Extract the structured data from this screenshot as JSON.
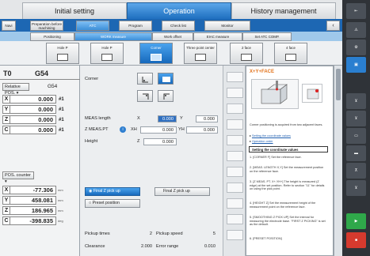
{
  "top_tabs": [
    "Initial setting",
    "Operation",
    "History management"
  ],
  "nav_tabs": [
    "Navi",
    "Preparation before machining",
    "ATC",
    "Program",
    "Check list",
    "Monitor"
  ],
  "measure_tabs": [
    "Positioning",
    "WORK measure",
    "Work offset",
    "EIAC measure",
    "Set ATC COMP."
  ],
  "sub_tabs": [
    "Hole P",
    "Hole P",
    "Corner",
    "Three point center",
    "2 face",
    "4 face"
  ],
  "status": {
    "tool": "T0",
    "gcode": "G54",
    "pos_mode": "Relative POS.",
    "pos_g": "G54"
  },
  "relative_pos": [
    {
      "axis": "X",
      "value": "0.000",
      "suffix": "#1"
    },
    {
      "axis": "Y",
      "value": "0.000",
      "suffix": "#1"
    },
    {
      "axis": "Z",
      "value": "0.000",
      "suffix": "#1"
    },
    {
      "axis": "C",
      "value": "0.000",
      "suffix": "#1"
    }
  ],
  "pos_counter_label": "POS. counter",
  "pos_counter": [
    {
      "axis": "X",
      "value": "-77.306",
      "unit": "mm"
    },
    {
      "axis": "Y",
      "value": "458.081",
      "unit": "mm"
    },
    {
      "axis": "Z",
      "value": "186.965",
      "unit": "mm"
    },
    {
      "axis": "C",
      "value": "-398.835",
      "unit": "deg"
    }
  ],
  "form": {
    "corner_label": "Corner",
    "meas_length_label": "MEAS length",
    "meas_x_label": "X",
    "meas_x": "0.000",
    "meas_y_label": "Y",
    "meas_y": "0.000",
    "zmeas_label": "Z MEAS.PT",
    "zmeas_xh_label": "XH",
    "zmeas_xh": "0.000",
    "zmeas_yh_label": "YH",
    "zmeas_yh": "0.000",
    "height_label": "Height",
    "height_z_label": "Z",
    "height_z": "0.000",
    "final_z_1": "Final Z pick up",
    "final_z_2": "Final Z pick up",
    "preset_position": "Preset position",
    "pickup_times_label": "Pickup times",
    "pickup_times": "2",
    "pickup_speed_label": "Pickup speed",
    "pickup_speed": "5",
    "clearance_label": "Clearance",
    "clearance": "2.000",
    "error_range_label": "Error range",
    "error_range": "0.010"
  },
  "help": {
    "title": "X+Y+FACE",
    "intro": "Corner positioning is acquired from two adjacent faces.",
    "link1": "Setting the coordinate values",
    "link2": "Operation order",
    "section": "Setting the coordinate values",
    "items": [
      "1. [CORNER F] Set the reference face.",
      "2. [MEAS. LENGTH X,Y] Set the measurement position on the reference face.",
      "3. [Z MEAS. PT. X+,YH+] The height is measured (Z edge) at the set position. Refer to section \"11\" for details on using the pick point.",
      "4. [HEIGHT Z] Set the measurement height of the measurement point on the reference face.",
      "5. [SMOOTHING Z PICK UP] Set the interval for measuring the electrode base. \"FIRST Z PICKING\" is set as the default.",
      "6. [PRESET POSITION]"
    ]
  },
  "sidebar_icons": [
    "back-icon",
    "alarm-icon",
    "tool-icon",
    "lock-icon",
    "measure-icon",
    "probe-icon",
    "table-icon",
    "display-icon",
    "jog-icon",
    "spindle-icon",
    "start-icon",
    "stop-icon"
  ]
}
